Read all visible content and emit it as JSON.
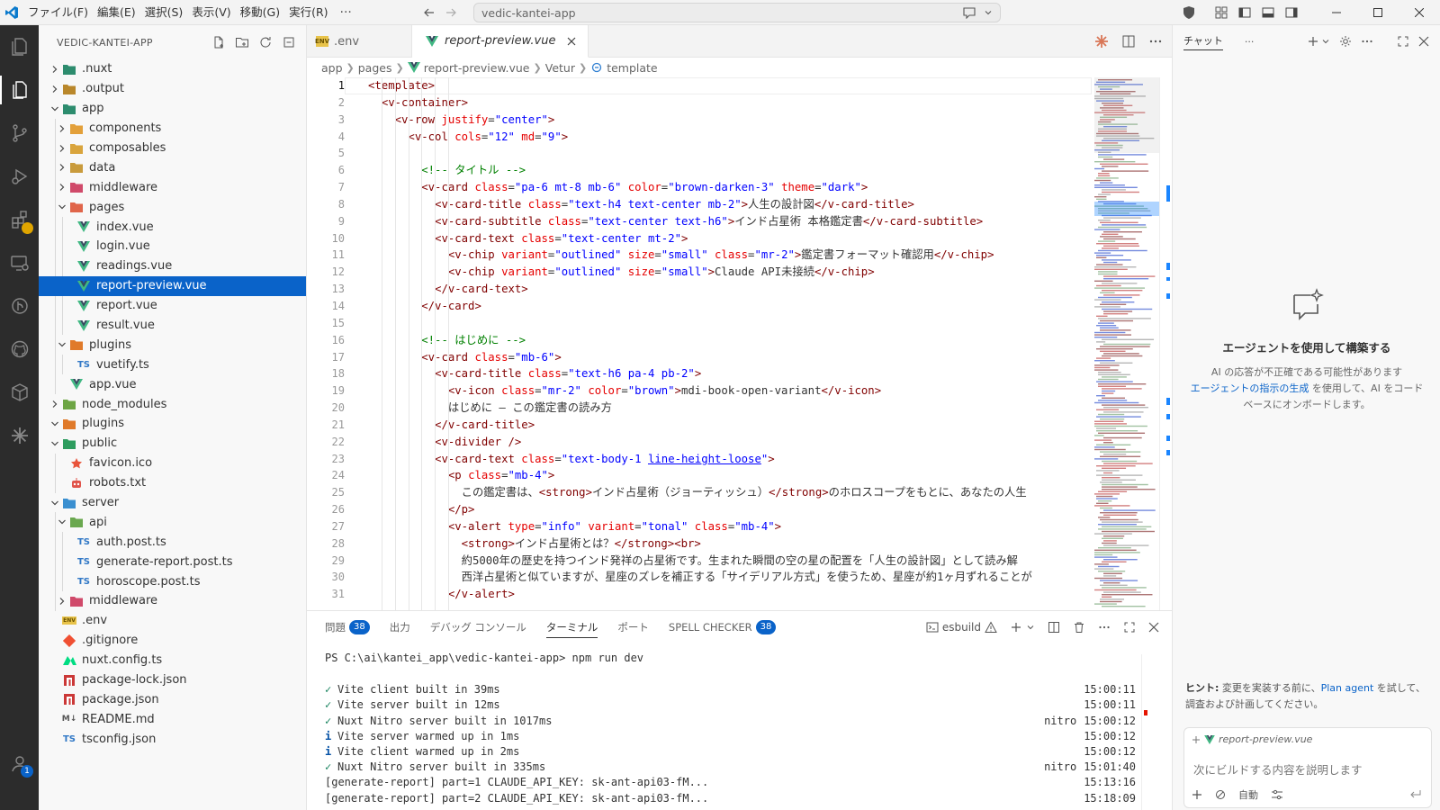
{
  "titlebar": {
    "menus": [
      "ファイル(F)",
      "編集(E)",
      "選択(S)",
      "表示(V)",
      "移動(G)",
      "実行(R)"
    ],
    "more": "···",
    "search": "vedic-kantei-app"
  },
  "activity": {
    "items": [
      "explorer",
      "files",
      "source-control",
      "run-debug",
      "extensions",
      "remote",
      "git-graph",
      "github",
      "containers",
      "claude"
    ],
    "account_badge": "1"
  },
  "explorer": {
    "title": "VEDIC-KANTEI-APP",
    "tree": [
      {
        "label": ".nuxt",
        "depth": 0,
        "type": "folder",
        "open": false,
        "icon": "#3aa",
        "iconColor": "#2d8c6e"
      },
      {
        "label": ".output",
        "depth": 0,
        "type": "folder",
        "open": false,
        "iconColor": "#b9872b"
      },
      {
        "label": "app",
        "depth": 0,
        "type": "folder",
        "open": true,
        "iconColor": "#2d8c6e"
      },
      {
        "label": "components",
        "depth": 1,
        "type": "folder",
        "open": false,
        "iconColor": "#e3a03a"
      },
      {
        "label": "composables",
        "depth": 1,
        "type": "folder",
        "open": false,
        "iconColor": "#d9a43c"
      },
      {
        "label": "data",
        "depth": 1,
        "type": "folder",
        "open": false,
        "iconColor": "#c99b3c"
      },
      {
        "label": "middleware",
        "depth": 1,
        "type": "folder",
        "open": false,
        "iconColor": "#d04a6a"
      },
      {
        "label": "pages",
        "depth": 1,
        "type": "folder",
        "open": true,
        "iconColor": "#e0654a"
      },
      {
        "label": "index.vue",
        "depth": 2,
        "type": "vue"
      },
      {
        "label": "login.vue",
        "depth": 2,
        "type": "vue"
      },
      {
        "label": "readings.vue",
        "depth": 2,
        "type": "vue"
      },
      {
        "label": "report-preview.vue",
        "depth": 2,
        "type": "vue",
        "selected": true
      },
      {
        "label": "report.vue",
        "depth": 2,
        "type": "vue"
      },
      {
        "label": "result.vue",
        "depth": 2,
        "type": "vue"
      },
      {
        "label": "plugins",
        "depth": 1,
        "type": "folder",
        "open": true,
        "iconColor": "#e07a2a"
      },
      {
        "label": "vuetify.ts",
        "depth": 2,
        "type": "ts"
      },
      {
        "label": "app.vue",
        "depth": 1,
        "type": "vue"
      },
      {
        "label": "node_modules",
        "depth": 0,
        "type": "folder",
        "open": false,
        "iconColor": "#6da544"
      },
      {
        "label": "plugins",
        "depth": 0,
        "type": "folder",
        "open": true,
        "iconColor": "#e07a2a"
      },
      {
        "label": "public",
        "depth": 0,
        "type": "folder",
        "open": true,
        "iconColor": "#2d9c5e"
      },
      {
        "label": "favicon.ico",
        "depth": 1,
        "type": "fav"
      },
      {
        "label": "robots.txt",
        "depth": 1,
        "type": "robot"
      },
      {
        "label": "server",
        "depth": 0,
        "type": "folder",
        "open": true,
        "iconColor": "#3a8fd0"
      },
      {
        "label": "api",
        "depth": 1,
        "type": "folder",
        "open": true,
        "iconColor": "#6aa84f"
      },
      {
        "label": "auth.post.ts",
        "depth": 2,
        "type": "ts"
      },
      {
        "label": "generate-report.post.ts",
        "depth": 2,
        "type": "ts"
      },
      {
        "label": "horoscope.post.ts",
        "depth": 2,
        "type": "ts"
      },
      {
        "label": "middleware",
        "depth": 1,
        "type": "folder",
        "open": false,
        "iconColor": "#d04a6a"
      },
      {
        "label": ".env",
        "depth": 0,
        "type": "env"
      },
      {
        "label": ".gitignore",
        "depth": 0,
        "type": "git"
      },
      {
        "label": "nuxt.config.ts",
        "depth": 0,
        "type": "nuxt"
      },
      {
        "label": "package-lock.json",
        "depth": 0,
        "type": "npm"
      },
      {
        "label": "package.json",
        "depth": 0,
        "type": "npm"
      },
      {
        "label": "README.md",
        "depth": 0,
        "type": "md"
      },
      {
        "label": "tsconfig.json",
        "depth": 0,
        "type": "ts"
      }
    ]
  },
  "editor": {
    "tabs": [
      {
        "label": ".env",
        "active": false
      },
      {
        "label": "report-preview.vue",
        "active": true
      }
    ],
    "breadcrumb": [
      "app",
      "pages",
      "report-preview.vue",
      "Vetur",
      "template"
    ],
    "line_numbers": [
      "1",
      "2",
      "3",
      "4",
      "5",
      "6",
      "7",
      "8",
      "9",
      "10",
      "11",
      "12",
      "13",
      "14",
      "15",
      "16",
      "17",
      "18",
      "19",
      "20",
      "21",
      "22",
      "23",
      "24",
      "25",
      "26",
      "27",
      "28",
      "29",
      "30",
      "31"
    ],
    "current_line": 1,
    "code": [
      {
        "i": 0,
        "s": [
          [
            "t",
            "<template>"
          ]
        ]
      },
      {
        "i": 1,
        "s": [
          [
            "t",
            "<v-container>"
          ]
        ]
      },
      {
        "i": 2,
        "s": [
          [
            "t",
            "<v-row "
          ],
          [
            "a",
            "justify"
          ],
          [
            "",
            "="
          ],
          [
            "v",
            "\"center\""
          ],
          [
            "t",
            ">"
          ]
        ]
      },
      {
        "i": 3,
        "s": [
          [
            "t",
            "<v-col "
          ],
          [
            "a",
            "cols"
          ],
          [
            "",
            "="
          ],
          [
            "v",
            "\"12\""
          ],
          [
            "a",
            " md"
          ],
          [
            "",
            "="
          ],
          [
            "v",
            "\"9\""
          ],
          [
            "t",
            ">"
          ]
        ]
      },
      {
        "i": 0,
        "s": []
      },
      {
        "i": 4,
        "s": [
          [
            "c",
            "<!-- タイトル -->"
          ]
        ]
      },
      {
        "i": 4,
        "s": [
          [
            "t",
            "<v-card "
          ],
          [
            "a",
            "class"
          ],
          [
            "",
            "="
          ],
          [
            "v",
            "\"pa-6 mt-8 mb-6\""
          ],
          [
            "a",
            " color"
          ],
          [
            "",
            "="
          ],
          [
            "v",
            "\"brown-darken-3\""
          ],
          [
            "a",
            " theme"
          ],
          [
            "",
            "="
          ],
          [
            "v",
            "\"dark\""
          ],
          [
            "t",
            ">"
          ]
        ]
      },
      {
        "i": 5,
        "s": [
          [
            "t",
            "<v-card-title "
          ],
          [
            "a",
            "class"
          ],
          [
            "",
            "="
          ],
          [
            "v",
            "\"text-h4 text-center mb-2\""
          ],
          [
            "t",
            ">"
          ],
          [
            "",
            "人生の設計図"
          ],
          [
            "t",
            "</v-card-title>"
          ]
        ]
      },
      {
        "i": 5,
        "s": [
          [
            "t",
            "<v-card-subtitle "
          ],
          [
            "a",
            "class"
          ],
          [
            "",
            "="
          ],
          [
            "v",
            "\"text-center text-h6\""
          ],
          [
            "t",
            ">"
          ],
          [
            "",
            "インド占星術 本格鑑定書"
          ],
          [
            "t",
            "</v-card-subtitle>"
          ]
        ]
      },
      {
        "i": 5,
        "s": [
          [
            "t",
            "<v-card-text "
          ],
          [
            "a",
            "class"
          ],
          [
            "",
            "="
          ],
          [
            "v",
            "\"text-center mt-2\""
          ],
          [
            "t",
            ">"
          ]
        ]
      },
      {
        "i": 6,
        "s": [
          [
            "t",
            "<v-chip "
          ],
          [
            "a",
            "variant"
          ],
          [
            "",
            "="
          ],
          [
            "v",
            "\"outlined\""
          ],
          [
            "a",
            " size"
          ],
          [
            "",
            "="
          ],
          [
            "v",
            "\"small\""
          ],
          [
            "a",
            " class"
          ],
          [
            "",
            "="
          ],
          [
            "v",
            "\"mr-2\""
          ],
          [
            "t",
            ">"
          ],
          [
            "",
            "鑑定書フォーマット確認用"
          ],
          [
            "t",
            "</v-chip>"
          ]
        ]
      },
      {
        "i": 6,
        "s": [
          [
            "t",
            "<v-chip "
          ],
          [
            "a",
            "variant"
          ],
          [
            "",
            "="
          ],
          [
            "v",
            "\"outlined\""
          ],
          [
            "a",
            " size"
          ],
          [
            "",
            "="
          ],
          [
            "v",
            "\"small\""
          ],
          [
            "t",
            ">"
          ],
          [
            "",
            "Claude API未接続"
          ],
          [
            "t",
            "</v-chip>"
          ]
        ]
      },
      {
        "i": 5,
        "s": [
          [
            "t",
            "</v-card-text>"
          ]
        ]
      },
      {
        "i": 4,
        "s": [
          [
            "t",
            "</v-card>"
          ]
        ]
      },
      {
        "i": 0,
        "s": []
      },
      {
        "i": 4,
        "s": [
          [
            "c",
            "<!-- はじめに -->"
          ]
        ]
      },
      {
        "i": 4,
        "s": [
          [
            "t",
            "<v-card "
          ],
          [
            "a",
            "class"
          ],
          [
            "",
            "="
          ],
          [
            "v",
            "\"mb-6\""
          ],
          [
            "t",
            ">"
          ]
        ]
      },
      {
        "i": 5,
        "s": [
          [
            "t",
            "<v-card-title "
          ],
          [
            "a",
            "class"
          ],
          [
            "",
            "="
          ],
          [
            "v",
            "\"text-h6 pa-4 pb-2\""
          ],
          [
            "t",
            ">"
          ]
        ]
      },
      {
        "i": 6,
        "s": [
          [
            "t",
            "<v-icon "
          ],
          [
            "a",
            "class"
          ],
          [
            "",
            "="
          ],
          [
            "v",
            "\"mr-2\""
          ],
          [
            "a",
            " color"
          ],
          [
            "",
            "="
          ],
          [
            "v",
            "\"brown\""
          ],
          [
            "t",
            ">"
          ],
          [
            "",
            "mdi-book-open-variant"
          ],
          [
            "t",
            "</v-icon>"
          ]
        ]
      },
      {
        "i": 6,
        "s": [
          [
            "",
            "はじめに — この鑑定書の読み方"
          ]
        ]
      },
      {
        "i": 5,
        "s": [
          [
            "t",
            "</v-card-title>"
          ]
        ]
      },
      {
        "i": 5,
        "s": [
          [
            "t",
            "<v-divider />"
          ]
        ]
      },
      {
        "i": 5,
        "s": [
          [
            "t",
            "<v-card-text "
          ],
          [
            "a",
            "class"
          ],
          [
            "",
            "="
          ],
          [
            "v",
            "\"text-body-1 "
          ],
          [
            "vu",
            "line-height-loose"
          ],
          [
            "v",
            "\""
          ],
          [
            "t",
            ">"
          ]
        ]
      },
      {
        "i": 6,
        "s": [
          [
            "t",
            "<p "
          ],
          [
            "a",
            "class"
          ],
          [
            "",
            "="
          ],
          [
            "v",
            "\"mb-4\""
          ],
          [
            "t",
            ">"
          ]
        ]
      },
      {
        "i": 7,
        "s": [
          [
            "",
            "この鑑定書は、"
          ],
          [
            "t",
            "<strong>"
          ],
          [
            "",
            "インド占星術（ジョーティッシュ）"
          ],
          [
            "t",
            "</strong>"
          ],
          [
            "",
            "のホロスコープをもとに、あなたの人生"
          ]
        ]
      },
      {
        "i": 6,
        "s": [
          [
            "t",
            "</p>"
          ]
        ]
      },
      {
        "i": 6,
        "s": [
          [
            "t",
            "<v-alert "
          ],
          [
            "a",
            "type"
          ],
          [
            "",
            "="
          ],
          [
            "v",
            "\"info\""
          ],
          [
            "a",
            " variant"
          ],
          [
            "",
            "="
          ],
          [
            "v",
            "\"tonal\""
          ],
          [
            "a",
            " class"
          ],
          [
            "",
            "="
          ],
          [
            "v",
            "\"mb-4\""
          ],
          [
            "t",
            ">"
          ]
        ]
      },
      {
        "i": 7,
        "s": [
          [
            "t",
            "<strong>"
          ],
          [
            "",
            "インド占星術とは？"
          ],
          [
            "t",
            "</strong><br>"
          ]
        ]
      },
      {
        "i": 7,
        "s": [
          [
            "",
            "約5000年の歴史を持つインド発祥の占星術です。生まれた瞬間の空の星の配置を「人生の設計図」として読み解"
          ]
        ]
      },
      {
        "i": 7,
        "s": [
          [
            "",
            "西洋占星術と似ていますが、星座のズレを補正する「サイデリアル方式」を使うため、星座が約1ヶ月ずれることが"
          ]
        ]
      },
      {
        "i": 6,
        "s": [
          [
            "t",
            "</v-alert>"
          ]
        ]
      }
    ]
  },
  "panel": {
    "tabs": [
      {
        "label": "問題",
        "badge": "38"
      },
      {
        "label": "出力"
      },
      {
        "label": "デバッグ コンソール"
      },
      {
        "label": "ターミナル",
        "active": true
      },
      {
        "label": "ポート"
      },
      {
        "label": "SPELL CHECKER",
        "badge": "38"
      }
    ],
    "terminal_name": "esbuild",
    "prompt": "PS C:\\ai\\kantei_app\\vedic-kantei-app> ",
    "command": "npm run dev",
    "lines": [
      {
        "mark": "✓",
        "kind": "ok",
        "text": "Vite client built in 39ms",
        "src": "",
        "time": "15:00:11"
      },
      {
        "mark": "✓",
        "kind": "ok",
        "text": "Vite server built in 12ms",
        "src": "",
        "time": "15:00:11"
      },
      {
        "mark": "✓",
        "kind": "ok",
        "text": "Nuxt Nitro server built in 1017ms",
        "src": "nitro",
        "time": "15:00:12"
      },
      {
        "mark": "i",
        "kind": "info",
        "text": "Vite server warmed up in 1ms",
        "src": "",
        "time": "15:00:12"
      },
      {
        "mark": "i",
        "kind": "info",
        "text": "Vite client warmed up in 2ms",
        "src": "",
        "time": "15:00:12"
      },
      {
        "mark": "✓",
        "kind": "ok",
        "text": "Nuxt Nitro server built in 335ms",
        "src": "nitro",
        "time": "15:01:40"
      },
      {
        "mark": "",
        "kind": "",
        "text": "[generate-report] part=1 CLAUDE_API_KEY: sk-ant-api03-fM...",
        "src": "",
        "time": "15:13:16"
      },
      {
        "mark": "",
        "kind": "",
        "text": "[generate-report] part=2 CLAUDE_API_KEY: sk-ant-api03-fM...",
        "src": "",
        "time": "15:18:09"
      }
    ]
  },
  "chat": {
    "title": "チャット",
    "more": "···",
    "empty_title": "エージェントを使用して構築する",
    "empty_line1": "AI の応答が不正確である可能性があります",
    "empty_link": "エージェントの指示の生成",
    "empty_line2": " を使用して、AI をコードベースにオンボードします。",
    "hint_label": "ヒント:",
    "hint_text1": " 変更を実装する前に、",
    "hint_link": "Plan agent",
    "hint_text2": " を試して、調査および計画してください。",
    "context_file": "report-preview.vue",
    "input_placeholder": "次にビルドする内容を説明します",
    "mode": "自動"
  }
}
